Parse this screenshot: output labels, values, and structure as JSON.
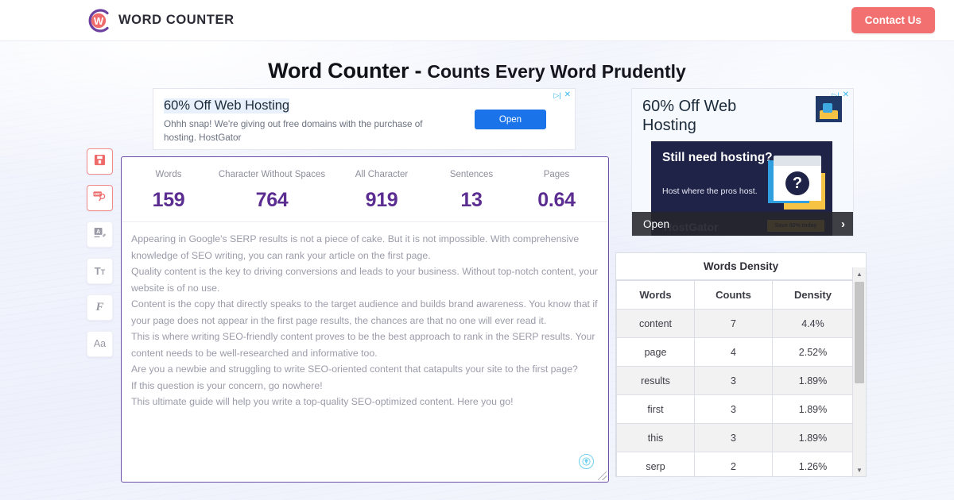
{
  "header": {
    "brand_name": "WORD COUNTER",
    "logo_icon": "circle-w-logo",
    "contact_label": "Contact Us",
    "contact_color": "#f2706f"
  },
  "title": {
    "main": "Word Counter -",
    "sub": "Counts Every Word Prudently"
  },
  "toolbar": {
    "items": [
      {
        "name": "save-button",
        "icon": "floppy-disk-icon",
        "glyph": "ὋE",
        "accent": true
      },
      {
        "name": "spell-check-button",
        "icon": "abc-spellcheck-icon",
        "glyph": "ABC",
        "accent": true
      },
      {
        "name": "clear-formatting-button",
        "icon": "text-eraser-icon",
        "glyph": "A",
        "accent": false
      },
      {
        "name": "font-size-button",
        "icon": "text-size-icon",
        "glyph": "Tt",
        "accent": false
      },
      {
        "name": "font-style-button",
        "icon": "script-font-icon",
        "glyph": "F",
        "accent": false
      },
      {
        "name": "letter-case-button",
        "icon": "letter-case-icon",
        "glyph": "Aa",
        "accent": false
      }
    ]
  },
  "banner_ad": {
    "headline": "60% Off Web Hosting",
    "body": "Ohhh snap! We're giving out free domains with the purchase of hosting. HostGator",
    "cta": "Open",
    "adchoices_icon": "adchoices-triangle-icon",
    "close_icon": "close-x-icon"
  },
  "stats": [
    {
      "label": "Words",
      "value": "159"
    },
    {
      "label": "Character Without Spaces",
      "value": "764"
    },
    {
      "label": "All Character",
      "value": "919"
    },
    {
      "label": "Sentences",
      "value": "13"
    },
    {
      "label": "Pages",
      "value": "0.64"
    }
  ],
  "editor": {
    "lines": [
      "Appearing in Google's SERP results is not a piece of cake. But it is not impossible. With comprehensive knowledge of SEO writing, you can rank your article on the first page.",
      "Quality content is the key to driving conversions and leads to your business. Without top-notch content, your website is of no use.",
      "Content is the copy that directly speaks to the target audience and builds brand awareness. You know that if your page does not appear in the first page results, the chances are that no one will ever read it.",
      "This is where writing SEO-friendly content proves to be the best approach to rank in the SERP results. Your content needs to be well-researched and informative too.",
      "Are you a newbie and struggling to write SEO-oriented content that catapults your site to the first page?",
      "If this question is your concern, go nowhere!",
      "This ultimate guide will help you write a top-quality SEO-optimized content. Here you go!"
    ],
    "grammar_icon": "grammar-check-icon",
    "resize_icon": "resize-grip-icon",
    "border_color": "#6b4fa8",
    "value_color": "#5b2d91"
  },
  "side_ad": {
    "headline": "60% Off Web Hosting",
    "creative_headline": "Still need hosting?",
    "creative_body": "Host where the pros host.",
    "creative_brand": "HostGator",
    "creative_cta": "Save 60% today",
    "open_label": "Open",
    "next_icon": "chevron-right-icon",
    "adchoices_icon": "adchoices-triangle-icon",
    "close_icon": "close-x-icon",
    "question_mark": "?"
  },
  "density": {
    "title": "Words Density",
    "columns": [
      "Words",
      "Counts",
      "Density"
    ],
    "rows": [
      {
        "word": "content",
        "count": "7",
        "density": "4.4%"
      },
      {
        "word": "page",
        "count": "4",
        "density": "2.52%"
      },
      {
        "word": "results",
        "count": "3",
        "density": "1.89%"
      },
      {
        "word": "first",
        "count": "3",
        "density": "1.89%"
      },
      {
        "word": "this",
        "count": "3",
        "density": "1.89%"
      },
      {
        "word": "serp",
        "count": "2",
        "density": "1.26%"
      }
    ],
    "scroll_up_icon": "scroll-up-arrow-icon",
    "scroll_down_icon": "scroll-down-arrow-icon"
  }
}
